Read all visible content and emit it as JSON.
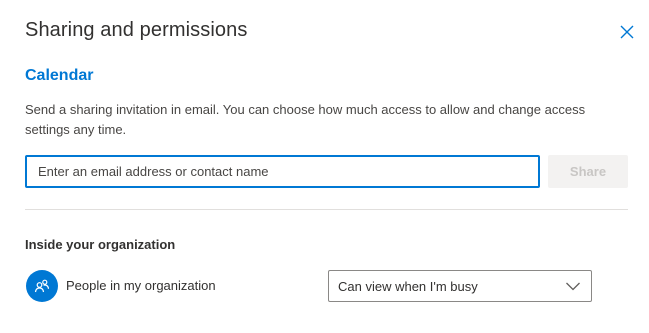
{
  "dialog": {
    "title": "Sharing and permissions",
    "close_icon": "close-icon"
  },
  "calendar": {
    "name": "Calendar",
    "description": "Send a sharing invitation in email. You can choose how much access to allow and change access settings any time."
  },
  "invite": {
    "placeholder": "Enter an email address or contact name",
    "value": "",
    "share_label": "Share"
  },
  "organization": {
    "heading": "Inside your organization",
    "entries": [
      {
        "label": "People in my organization",
        "icon": "people-icon",
        "permission": "Can view when I'm busy"
      }
    ]
  },
  "colors": {
    "accent": "#0078d4",
    "disabled_bg": "#f3f2f1",
    "disabled_text": "#c8c6c4"
  }
}
